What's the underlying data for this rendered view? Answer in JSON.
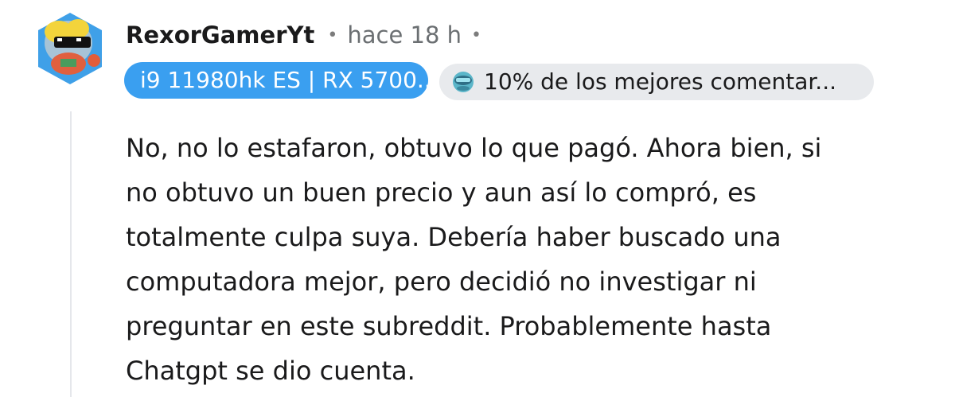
{
  "comment": {
    "author": "RexorGamerYt",
    "separator": "•",
    "timestamp": "hace 18 h",
    "trailing_separator": "•",
    "flairs": {
      "user_flair": "i9 11980hk ES | RX 5700...",
      "achievement": "10% de los mejores comentar..."
    },
    "body_lines": [
      "No, no lo estafaron, obtuvo lo que pagó. Ahora bien, si",
      "no obtuvo un buen precio y aun así lo compró, es",
      "totalmente culpa suya. Debería haber buscado una",
      "computadora mejor, pero decidió no investigar ni",
      "preguntar en este subreddit. Probablemente hasta",
      "Chatgpt se dio cuenta."
    ]
  },
  "colors": {
    "user_flair_bg": "#3a9ff0",
    "achievement_bg": "#e8eaed",
    "thread_line": "#e5e7eb"
  },
  "icons": {
    "avatar": "snoo-avatar-with-sunglasses",
    "achievement": "top-commenter-badge-icon"
  }
}
